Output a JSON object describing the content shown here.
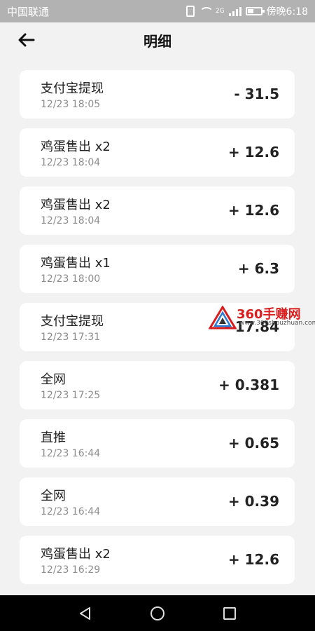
{
  "status_bar": {
    "carrier": "中国联通",
    "network": "2G",
    "time": "傍晚6:18"
  },
  "header": {
    "title": "明细"
  },
  "records": [
    {
      "title": "支付宝提现",
      "time": "12/23 18:05",
      "amount": "- 31.5"
    },
    {
      "title": "鸡蛋售出 x2",
      "time": "12/23 18:04",
      "amount": "+ 12.6"
    },
    {
      "title": "鸡蛋售出 x2",
      "time": "12/23 18:04",
      "amount": "+ 12.6"
    },
    {
      "title": "鸡蛋售出 x1",
      "time": "12/23 18:00",
      "amount": "+ 6.3"
    },
    {
      "title": "支付宝提现",
      "time": "12/23 17:31",
      "amount": "- 17.84"
    },
    {
      "title": "全网",
      "time": "12/23 17:25",
      "amount": "+ 0.381"
    },
    {
      "title": "直推",
      "time": "12/23 16:44",
      "amount": "+ 0.65"
    },
    {
      "title": "全网",
      "time": "12/23 16:44",
      "amount": "+ 0.39"
    },
    {
      "title": "鸡蛋售出 x2",
      "time": "12/23 16:29",
      "amount": "+ 12.6"
    }
  ],
  "watermark": {
    "title": "360手赚网",
    "url": "www.360shouzhuan.com"
  },
  "icons": {
    "back": "arrow-left-icon",
    "nav_back": "triangle-back-icon",
    "nav_home": "circle-home-icon",
    "nav_recent": "square-recent-icon"
  },
  "colors": {
    "status_bar_bg": "#b2b2b2",
    "page_bg": "#f2f2f2",
    "card_bg": "#ffffff",
    "text_primary": "#222222",
    "text_secondary": "#8c8c8c",
    "watermark_red": "#d91c1c"
  }
}
